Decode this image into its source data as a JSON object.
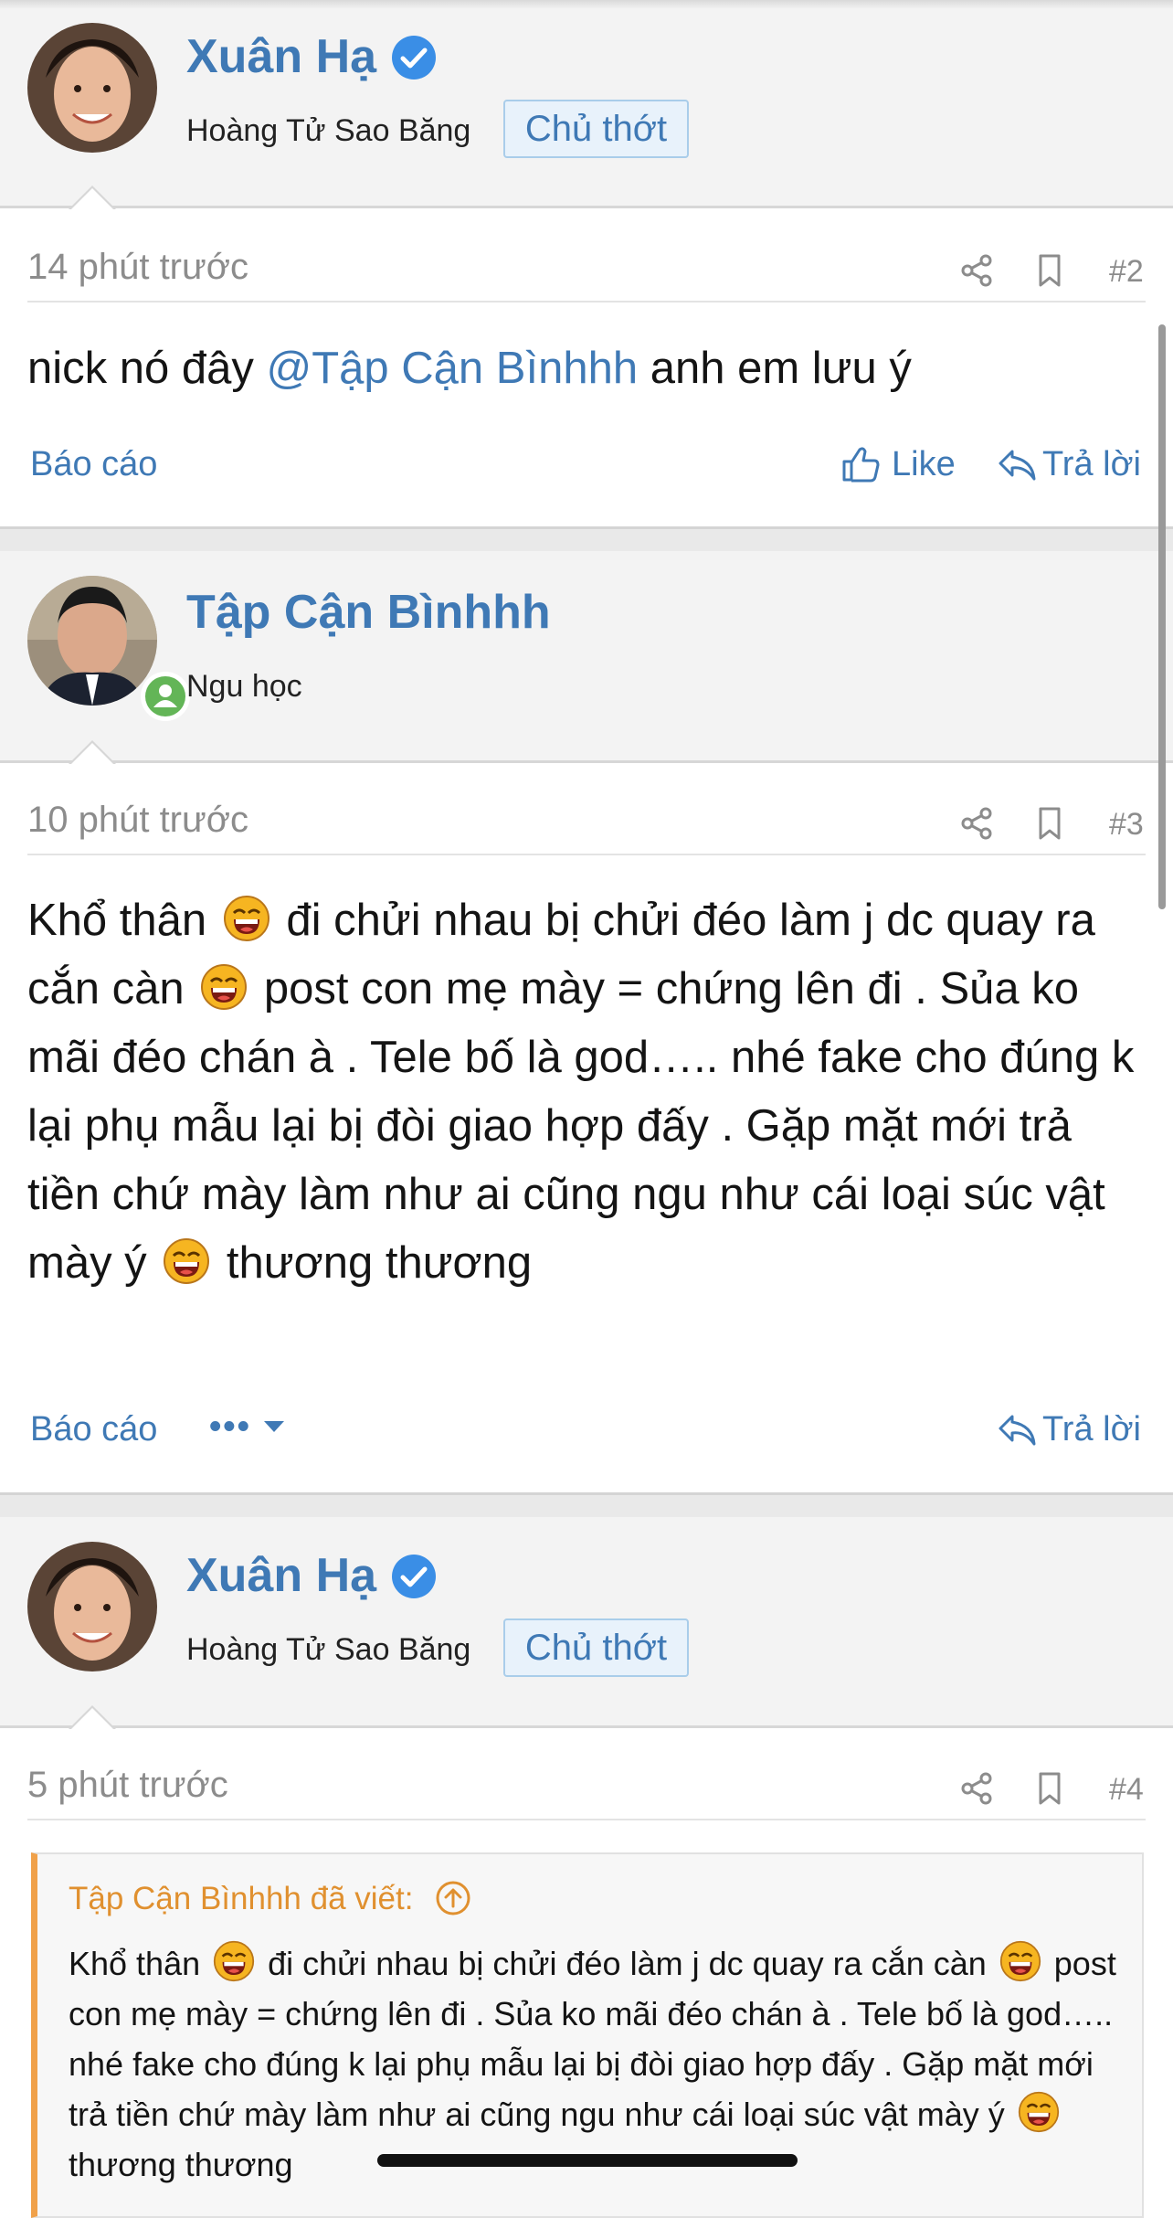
{
  "colors": {
    "accent": "#3f79b5",
    "quote_accent": "#f0a14a",
    "muted": "#8c8c8c"
  },
  "post2": {
    "author": {
      "name": "Xuân Hạ",
      "title": "Hoàng Tử Sao Băng",
      "badge": "Chủ thớt",
      "verified_icon": "verified-check-icon"
    },
    "time": "14 phút trước",
    "number": "#2",
    "body": {
      "before": "nick nó đây ",
      "mention": "@Tập Cận Bìnhhh",
      "after": " anh em lưu ý"
    },
    "actions": {
      "report": "Báo cáo",
      "like": "Like",
      "reply": "Trả lời"
    }
  },
  "post3": {
    "author": {
      "name": "Tập Cận Bìnhhh",
      "title": "Ngu học",
      "status_icon": "online-user-icon"
    },
    "time": "10 phút trước",
    "number": "#3",
    "body": {
      "p1": "Khổ thân ",
      "p2": " đi chửi nhau bị chửi đéo làm j dc quay ra cắn càn ",
      "p3": " post con mẹ mày = chứng lên đi . Sủa ko mãi đéo chán à . Tele bố là god….. nhé fake cho đúng k lại phụ mẫu lại bị đòi giao hợp đấy . Gặp mặt mới trả tiền chứ mày làm như ai cũng ngu như cái loại súc vật mày ý ",
      "p4": " thương thương"
    },
    "actions": {
      "report": "Báo cáo",
      "more": "•••",
      "reply": "Trả lời"
    }
  },
  "post4": {
    "author": {
      "name": "Xuân Hạ",
      "title": "Hoàng Tử Sao Băng",
      "badge": "Chủ thớt"
    },
    "time": "5 phút trước",
    "number": "#4",
    "quote": {
      "header": "Tập Cận Bìnhhh đã viết:",
      "p1": "Khổ thân ",
      "p2": " đi chửi nhau bị chửi đéo làm j dc quay ra cắn càn ",
      "p3": " post con mẹ mày = chứng lên đi . Sủa ko mãi đéo chán à . Tele bố là god….. nhé fake cho đúng k lại phụ mẫu lại bị đòi giao hợp đấy . Gặp mặt mới trả tiền chứ mày làm như ai cũng ngu như cái loại súc vật mày ý ",
      "p4": " thương thương"
    }
  },
  "icons": [
    "share-icon",
    "bookmark-icon",
    "like-icon",
    "reply-icon",
    "laughing-emoji-icon",
    "quote-jump-icon",
    "chevron-down-icon"
  ]
}
